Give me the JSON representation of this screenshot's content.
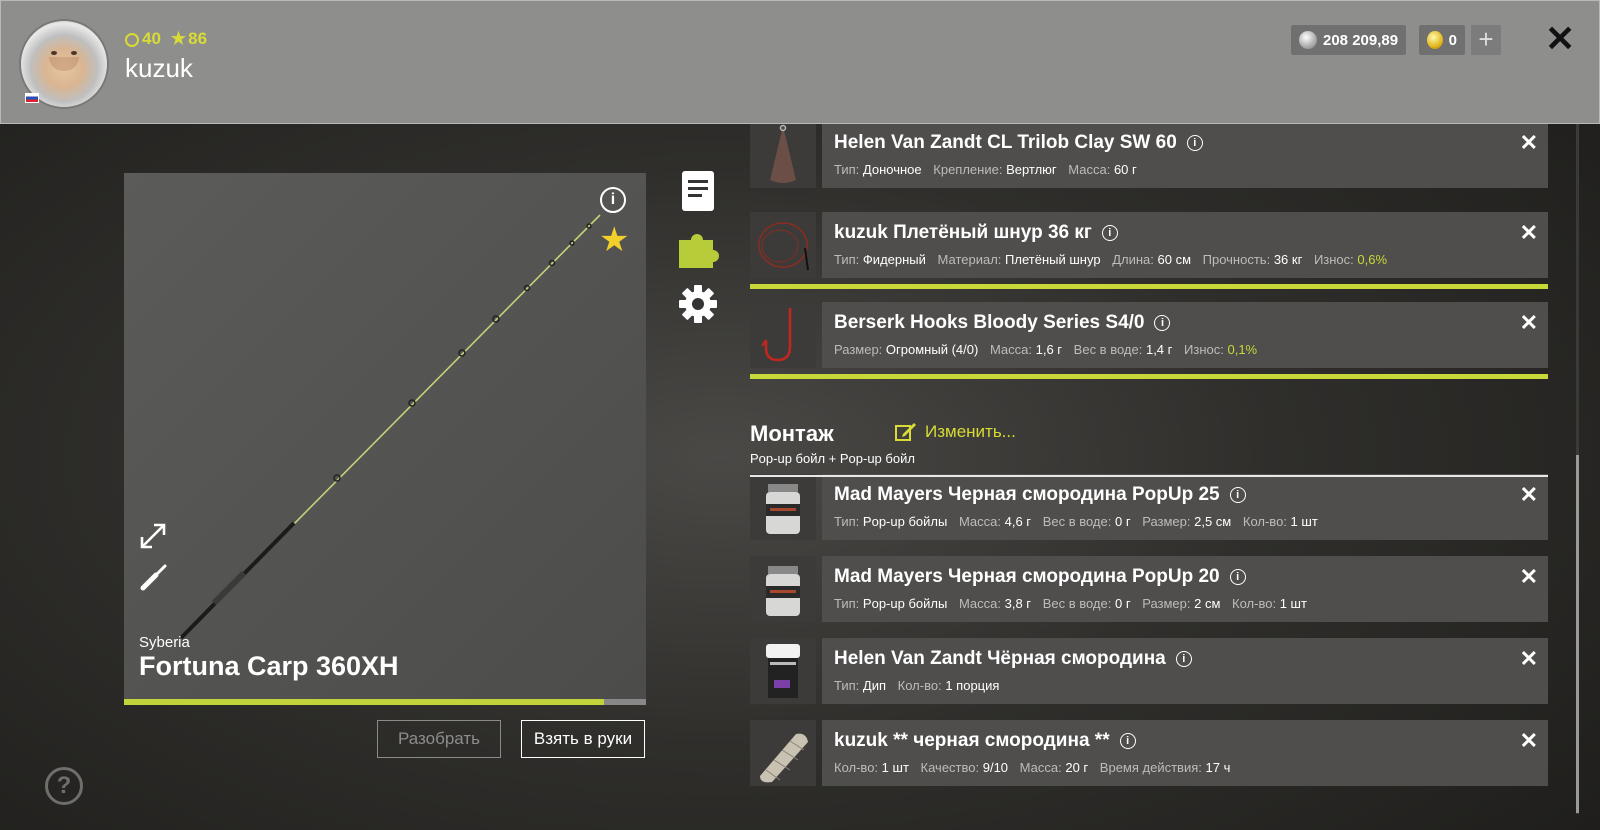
{
  "player": {
    "name": "kuzuk",
    "level": "40",
    "rank": "86"
  },
  "wallet": {
    "silver": "208 209,89",
    "gold": "0",
    "add_label": "+"
  },
  "rod": {
    "brand": "Syberia",
    "name": "Fortuna Carp 360XH",
    "durability": 0.92,
    "disassemble_label": "Разобрать",
    "take_label": "Взять в руки"
  },
  "items_top": [
    {
      "title": "Helen Van Zandt CL Trilob Clay SW 60",
      "props": [
        [
          "Тип:",
          "Доночное"
        ],
        [
          "Крепление:",
          "Вертлюг"
        ],
        [
          "Масса:",
          "60 г"
        ]
      ]
    },
    {
      "title": "kuzuk Плетёный шнур 36 кг",
      "props": [
        [
          "Тип:",
          "Фидерный"
        ],
        [
          "Материал:",
          "Плетёный шнур"
        ],
        [
          "Длина:",
          "60 см"
        ],
        [
          "Прочность:",
          "36 кг"
        ],
        [
          "Износ:",
          "0,6%"
        ]
      ]
    },
    {
      "title": "Berserk Hooks Bloody Series S4/0",
      "props": [
        [
          "Размер:",
          "Огромный (4/0)"
        ],
        [
          "Масса:",
          "1,6 г"
        ],
        [
          "Вес в воде:",
          "1,4 г"
        ],
        [
          "Износ:",
          "0,1%"
        ]
      ]
    }
  ],
  "montage": {
    "title": "Монтаж",
    "edit_label": "Изменить...",
    "subtitle": "Pop-up бойл  +  Pop-up бойл"
  },
  "items_bottom": [
    {
      "title": "Mad Mayers Черная смородина PopUp 25",
      "props": [
        [
          "Тип:",
          "Pop-up бойлы"
        ],
        [
          "Масса:",
          "4,6 г"
        ],
        [
          "Вес в воде:",
          "0 г"
        ],
        [
          "Размер:",
          "2,5 см"
        ],
        [
          "Кол-во:",
          "1 шт"
        ]
      ]
    },
    {
      "title": "Mad Mayers Черная смородина PopUp 20",
      "props": [
        [
          "Тип:",
          "Pop-up бойлы"
        ],
        [
          "Масса:",
          "3,8 г"
        ],
        [
          "Вес в воде:",
          "0 г"
        ],
        [
          "Размер:",
          "2 см"
        ],
        [
          "Кол-во:",
          "1 шт"
        ]
      ]
    },
    {
      "title": "Helen Van Zandt Чёрная смородина",
      "props": [
        [
          "Тип:",
          "Дип"
        ],
        [
          "Кол-во:",
          "1 порция"
        ]
      ]
    },
    {
      "title": "kuzuk ** черная смородина **",
      "props": [
        [
          "Кол-во:",
          "1 шт"
        ],
        [
          "Качество:",
          "9/10"
        ],
        [
          "Масса:",
          "20 г"
        ],
        [
          "Время действия:",
          "17 ч"
        ]
      ]
    }
  ],
  "colors": {
    "accent": "#c8d838",
    "card": "#4f4e4c"
  }
}
